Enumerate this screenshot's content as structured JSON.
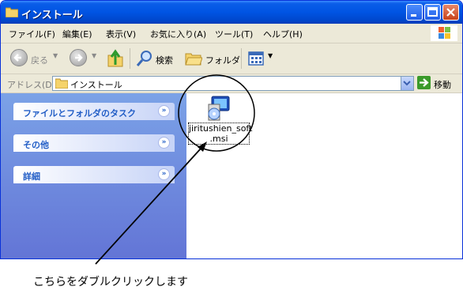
{
  "window": {
    "title": "インストール"
  },
  "menu": {
    "items": [
      "ファイル(F)",
      "編集(E)",
      "表示(V)",
      "お気に入り(A)",
      "ツール(T)",
      "ヘルプ(H)"
    ]
  },
  "toolbar": {
    "back_label": "戻る",
    "search_label": "検索",
    "folders_label": "フォルダ"
  },
  "address": {
    "label": "アドレス(D)",
    "value": "インストール",
    "go_label": "移動"
  },
  "sidebar": {
    "panels": [
      {
        "label": "ファイルとフォルダのタスク"
      },
      {
        "label": "その他"
      },
      {
        "label": "詳細"
      }
    ]
  },
  "file": {
    "name_line1": "jiritushien_soft",
    "name_line2": ".msi"
  },
  "annotation": {
    "caption": "こちらをダブルクリックします"
  }
}
